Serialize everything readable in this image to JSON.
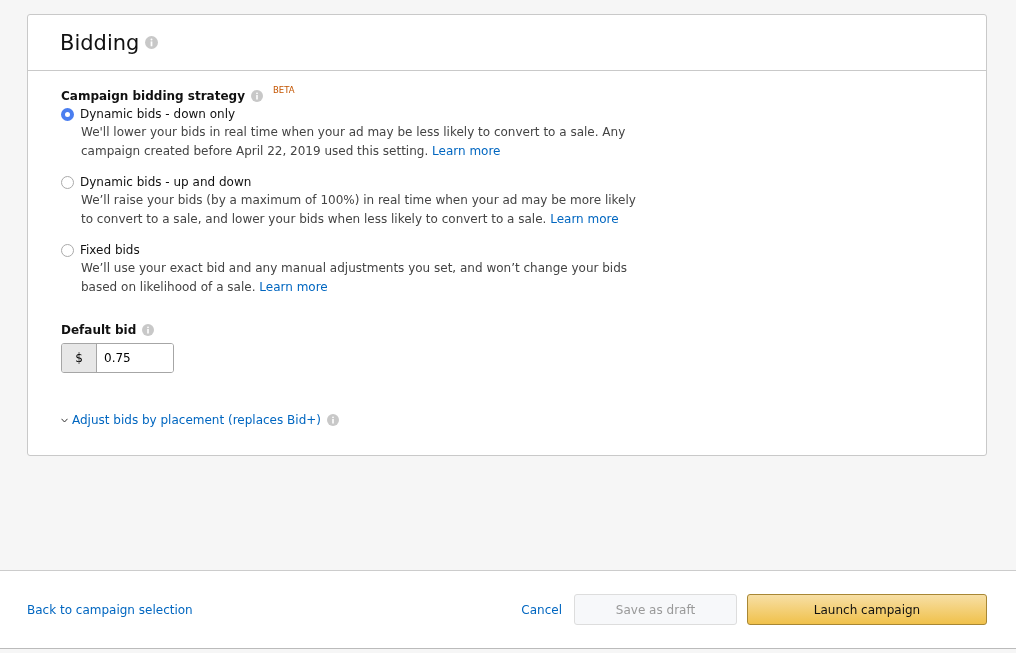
{
  "card": {
    "title": "Bidding"
  },
  "strategy": {
    "label": "Campaign bidding strategy",
    "badge": "BETA",
    "options": [
      {
        "label": "Dynamic bids - down only",
        "selected": true,
        "description": "We'll lower your bids in real time when your ad may be less likely to convert to a sale. Any campaign created before April 22, 2019 used this setting.",
        "link": "Learn more"
      },
      {
        "label": "Dynamic bids - up and down",
        "selected": false,
        "description": "We’ll raise your bids (by a maximum of 100%) in real time when your ad may be more likely to convert to a sale, and lower your bids when less likely to convert to a sale.",
        "link": "Learn more"
      },
      {
        "label": "Fixed bids",
        "selected": false,
        "description": "We’ll use your exact bid and any manual adjustments you set, and won’t change your bids based on likelihood of a sale.",
        "link": "Learn more"
      }
    ]
  },
  "default_bid": {
    "label": "Default bid",
    "currency": "$",
    "value": "0.75"
  },
  "placement": {
    "label": "Adjust bids by placement (replaces Bid+)",
    "expanded": false
  },
  "footer": {
    "back": "Back to campaign selection",
    "cancel": "Cancel",
    "save": {
      "label": "Save as draft",
      "disabled": true
    },
    "launch": "Launch campaign"
  }
}
